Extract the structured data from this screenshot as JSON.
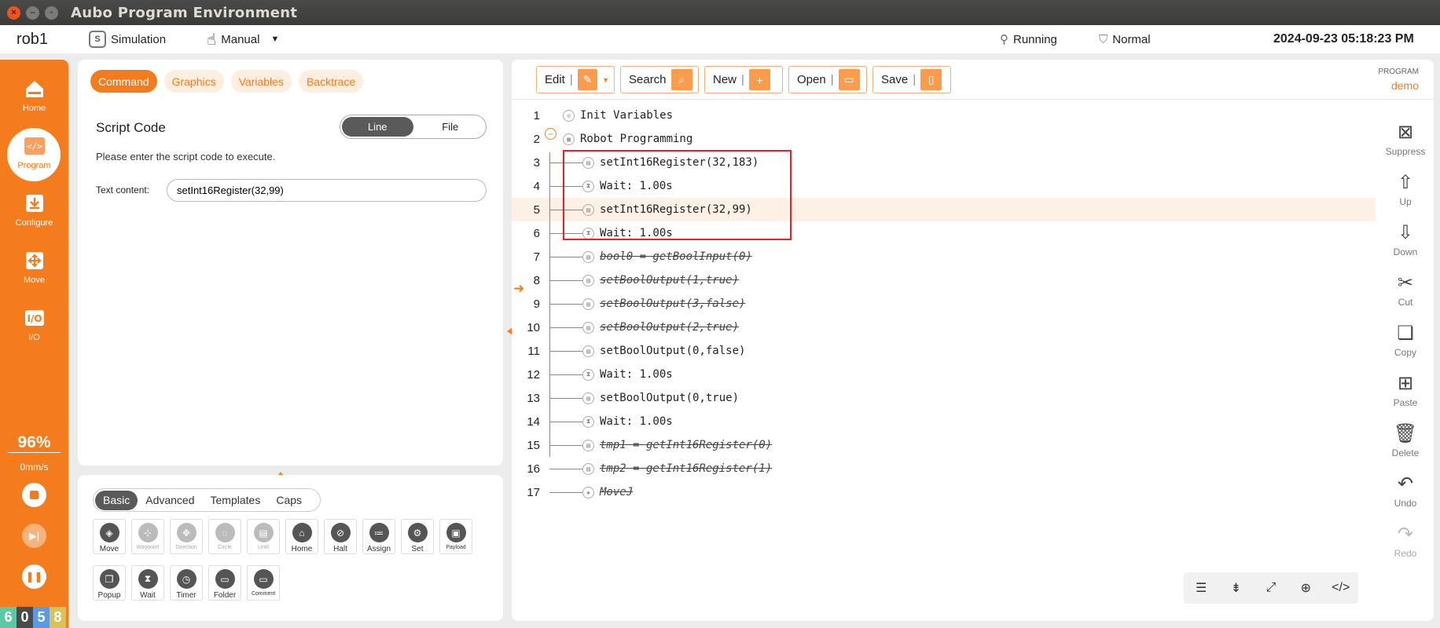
{
  "window": {
    "title": "Aubo Program Environment"
  },
  "status": {
    "robot": "rob1",
    "simulation": "Simulation",
    "mode": "Manual",
    "running": "Running",
    "safety": "Normal",
    "datetime": "2024-09-23 05:18:23 PM"
  },
  "nav": {
    "home": "Home",
    "program": "Program",
    "configure": "Configure",
    "move": "Move",
    "io": "I/O",
    "speed_pct": "96%",
    "speed": "0mm/s",
    "digits": [
      "6",
      "0",
      "5",
      "8"
    ],
    "digit_colors": [
      "#5bc8a8",
      "#4a4a4a",
      "#5a9be0",
      "#d9c25a"
    ]
  },
  "left_panel": {
    "tabs": [
      "Command",
      "Graphics",
      "Variables",
      "Backtrace"
    ],
    "script_title": "Script Code",
    "toggle": [
      "Line",
      "File"
    ],
    "hint": "Please enter the script code to execute.",
    "text_label": "Text content:",
    "text_value": "setInt16Register(32,99)"
  },
  "palette": {
    "tabs": [
      "Basic",
      "Advanced",
      "Templates",
      "Caps"
    ],
    "commands": [
      {
        "label": "Move",
        "icon": "◈",
        "enabled": true
      },
      {
        "label": "Waypoint",
        "icon": "⊹",
        "enabled": false
      },
      {
        "label": "Direction",
        "icon": "✥",
        "enabled": false
      },
      {
        "label": "Circle",
        "icon": "◌",
        "enabled": false
      },
      {
        "label": "Until",
        "icon": "▤",
        "enabled": false
      },
      {
        "label": "Home",
        "icon": "⌂",
        "enabled": true
      },
      {
        "label": "Halt",
        "icon": "⊘",
        "enabled": true
      },
      {
        "label": "Assign",
        "icon": "≔",
        "enabled": true
      },
      {
        "label": "Set",
        "icon": "⚙",
        "enabled": true
      },
      {
        "label": "Payload",
        "icon": "▣",
        "enabled": true
      },
      {
        "label": "Popup",
        "icon": "❐",
        "enabled": true
      },
      {
        "label": "Wait",
        "icon": "⧗",
        "enabled": true
      },
      {
        "label": "Timer",
        "icon": "◷",
        "enabled": true
      },
      {
        "label": "Folder",
        "icon": "▭",
        "enabled": true
      },
      {
        "label": "Comment",
        "icon": "▭",
        "enabled": true
      }
    ]
  },
  "editor": {
    "toolbar": [
      "Edit",
      "Search",
      "New",
      "Open",
      "Save"
    ],
    "program_label": "PROGRAM",
    "program_name": "demo",
    "lines": [
      {
        "n": "1",
        "text": "Init Variables",
        "level": 0,
        "icon": "⊙",
        "strike": false
      },
      {
        "n": "2",
        "text": "Robot Programming",
        "level": 0,
        "icon": "▦",
        "strike": false
      },
      {
        "n": "3",
        "text": "setInt16Register(32,183)",
        "level": 1,
        "icon": "▤",
        "strike": false
      },
      {
        "n": "4",
        "text": "Wait: 1.00s",
        "level": 1,
        "icon": "⧗",
        "strike": false
      },
      {
        "n": "5",
        "text": "setInt16Register(32,99)",
        "level": 1,
        "icon": "▤",
        "strike": false
      },
      {
        "n": "6",
        "text": "Wait: 1.00s",
        "level": 1,
        "icon": "⧗",
        "strike": false
      },
      {
        "n": "7",
        "text": "bool0 = getBoolInput(0)",
        "level": 1,
        "icon": "▤",
        "strike": true
      },
      {
        "n": "8",
        "text": "setBoolOutput(1,true)",
        "level": 1,
        "icon": "▤",
        "strike": true
      },
      {
        "n": "9",
        "text": "setBoolOutput(3,false)",
        "level": 1,
        "icon": "▤",
        "strike": true
      },
      {
        "n": "10",
        "text": "setBoolOutput(2,true)",
        "level": 1,
        "icon": "▤",
        "strike": true
      },
      {
        "n": "11",
        "text": "setBoolOutput(0,false)",
        "level": 1,
        "icon": "▤",
        "strike": false
      },
      {
        "n": "12",
        "text": "Wait: 1.00s",
        "level": 1,
        "icon": "⧗",
        "strike": false
      },
      {
        "n": "13",
        "text": "setBoolOutput(0,true)",
        "level": 1,
        "icon": "▤",
        "strike": false
      },
      {
        "n": "14",
        "text": "Wait: 1.00s",
        "level": 1,
        "icon": "⧗",
        "strike": false
      },
      {
        "n": "15",
        "text": "tmp1 = getInt16Register(0)",
        "level": 1,
        "icon": "▤",
        "strike": true
      },
      {
        "n": "16",
        "text": "tmp2 = getInt16Register(1)",
        "level": 1,
        "icon": "▤",
        "strike": true
      },
      {
        "n": "17",
        "text": "MoveJ",
        "level": 1,
        "icon": "◈",
        "strike": true
      }
    ],
    "selected_line": "5",
    "current_line": "6"
  },
  "actions": [
    {
      "label": "Suppress",
      "icon": "⊠",
      "enabled": true
    },
    {
      "label": "Up",
      "icon": "⇧",
      "enabled": true
    },
    {
      "label": "Down",
      "icon": "⇩",
      "enabled": true
    },
    {
      "label": "Cut",
      "icon": "✂",
      "enabled": true
    },
    {
      "label": "Copy",
      "icon": "❏",
      "enabled": true
    },
    {
      "label": "Paste",
      "icon": "⊞",
      "enabled": true
    },
    {
      "label": "Delete",
      "icon": "🗑",
      "enabled": true
    },
    {
      "label": "Undo",
      "icon": "↶",
      "enabled": true
    },
    {
      "label": "Redo",
      "icon": "↷",
      "enabled": false
    }
  ],
  "colors": {
    "accent": "#f47c1c",
    "highlight": "#e5222b"
  }
}
